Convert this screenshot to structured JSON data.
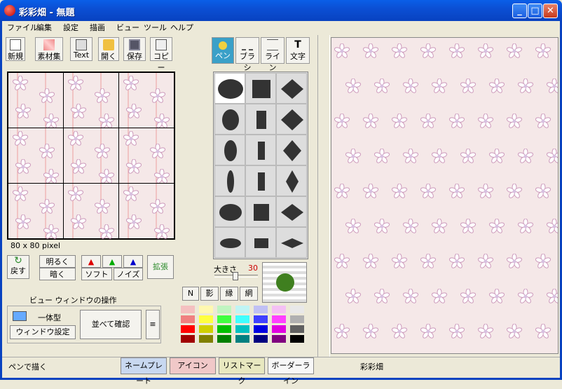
{
  "window": {
    "title": "彩彩畑 - 無題"
  },
  "menu": [
    "ファイル",
    "編集",
    "設定",
    "描画",
    "ビュー",
    "ツール",
    "ヘルプ"
  ],
  "toolbar": {
    "new": "新規",
    "material": "素材集",
    "text": "Text",
    "open": "開く",
    "save": "保存",
    "copy": "コピー"
  },
  "tools": {
    "pen": "ペン",
    "brush": "ブラシ",
    "line": "ライン",
    "char": "文字"
  },
  "pattern": {
    "size_label": "80 x 80 pixel"
  },
  "adjust": {
    "undo": "戻す",
    "bright": "明るく",
    "dark": "暗く",
    "soft": "ソフト",
    "noise": "ノイズ",
    "expand": "拡張"
  },
  "view_ops": {
    "heading": "ビュー ウィンドウの操作",
    "integrated": "一体型",
    "window_settings": "ウィンドウ設定",
    "tile_check": "並べて確認",
    "menu_glyph": "≡"
  },
  "brush_size": {
    "label": "大きさ",
    "value": "30"
  },
  "modes": [
    "N",
    "影",
    "縁",
    "網"
  ],
  "tabs": [
    "ネームプレート",
    "アイコン",
    "リストマーク",
    "ボーダーライン"
  ],
  "status": {
    "left": "ペンで描く",
    "right": "彩彩畑"
  },
  "colors": {
    "accent": "#0A5FE8",
    "brush_preview": "#3f7f1f"
  }
}
